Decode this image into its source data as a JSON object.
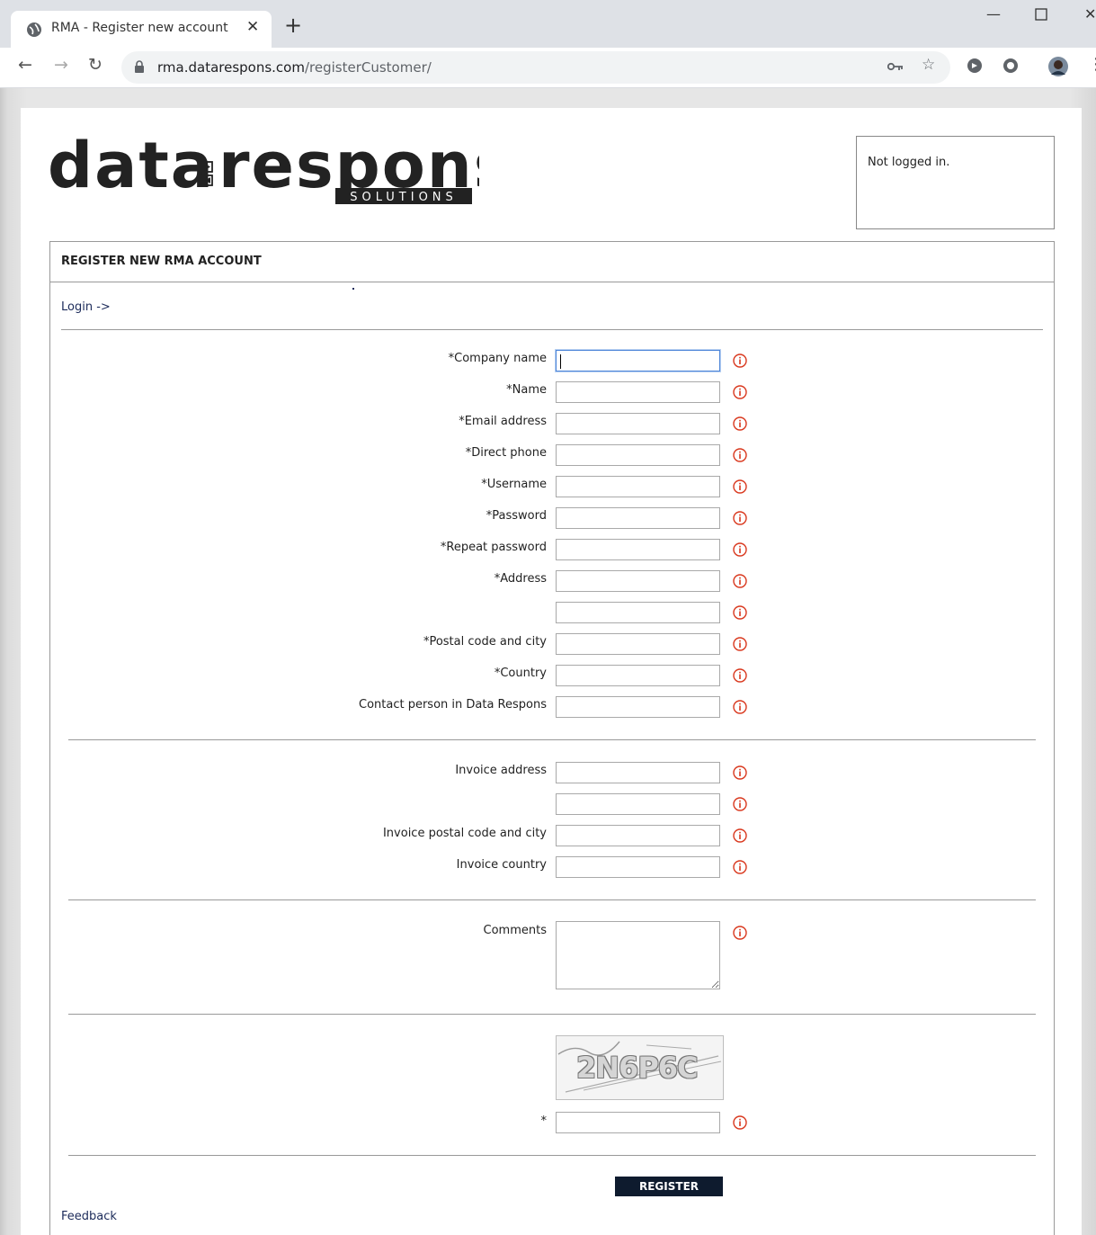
{
  "browser": {
    "tab_title": "RMA - Register new account",
    "url_host": "rma.datarespons.com",
    "url_path": "/registerCustomer/"
  },
  "logo": {
    "brand": "data respons",
    "tagline": "SOLUTIONS"
  },
  "status": {
    "text": "Not logged in."
  },
  "form": {
    "title": "REGISTER NEW RMA ACCOUNT",
    "login_link": "Login ->",
    "labels": {
      "company": "*Company name",
      "name": "*Name",
      "email": "*Email address",
      "phone": "*Direct phone",
      "username": "*Username",
      "password": "*Password",
      "repeat_password": "*Repeat password",
      "address": "*Address",
      "postal": "*Postal code and city",
      "country": "*Country",
      "contact": "Contact person in Data Respons",
      "invoice_address": "Invoice address",
      "invoice_postal": "Invoice postal code and city",
      "invoice_country": "Invoice country",
      "comments": "Comments",
      "captcha_field": "*"
    },
    "captcha_text": "2N6P6C",
    "register_label": "REGISTER",
    "feedback_label": "Feedback"
  },
  "colors": {
    "accent_dark": "#0e1b2e",
    "info_red": "#d9371d",
    "link": "#1c2b5a"
  }
}
